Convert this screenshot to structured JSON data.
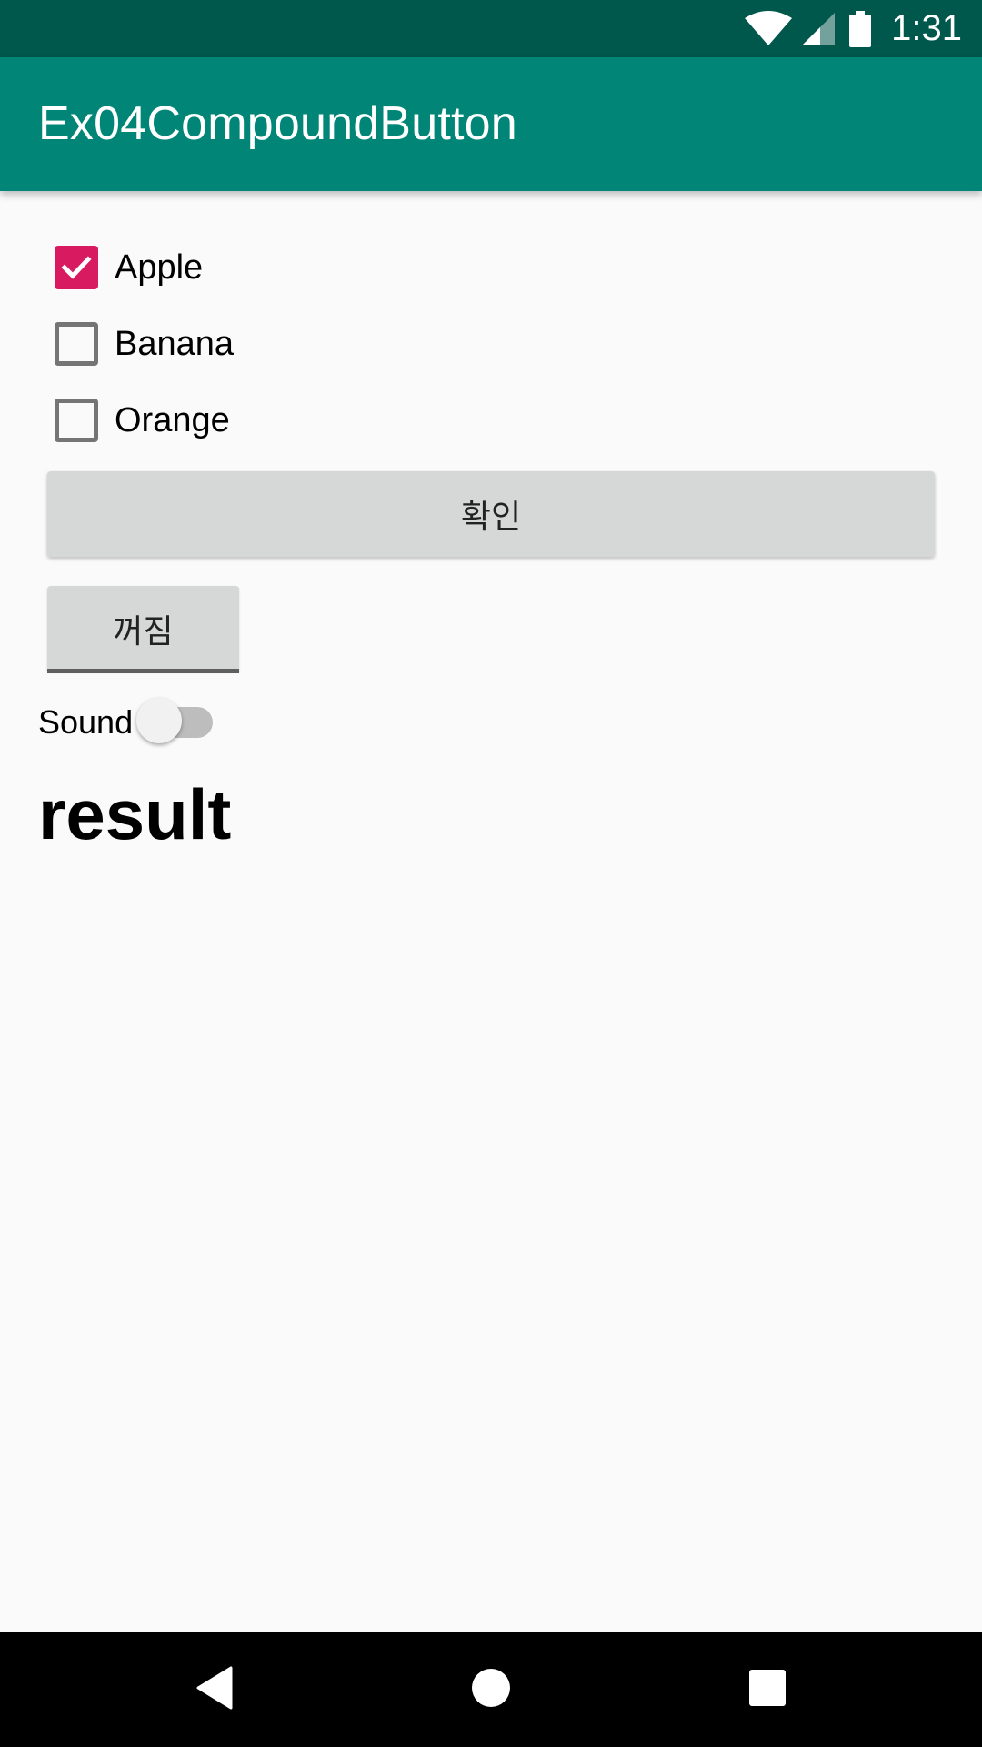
{
  "status_bar": {
    "time": "1:31",
    "icons": [
      "wifi-icon",
      "cell-signal-icon",
      "battery-icon"
    ],
    "background_color": "#00574b"
  },
  "app_bar": {
    "title": "Ex04CompoundButton",
    "background_color": "#008577"
  },
  "checkboxes": [
    {
      "label": "Apple",
      "checked": true
    },
    {
      "label": "Banana",
      "checked": false
    },
    {
      "label": "Orange",
      "checked": false
    }
  ],
  "confirm_button": {
    "label": "확인"
  },
  "toggle_button": {
    "label": "꺼짐",
    "checked": false
  },
  "sound_switch": {
    "label": "Sound",
    "on": false
  },
  "result_text": "result",
  "nav_bar": {
    "buttons": [
      "back-icon",
      "home-icon",
      "recents-icon"
    ]
  },
  "colors": {
    "accent": "#d81b60",
    "button_background": "#d6d7d7"
  }
}
